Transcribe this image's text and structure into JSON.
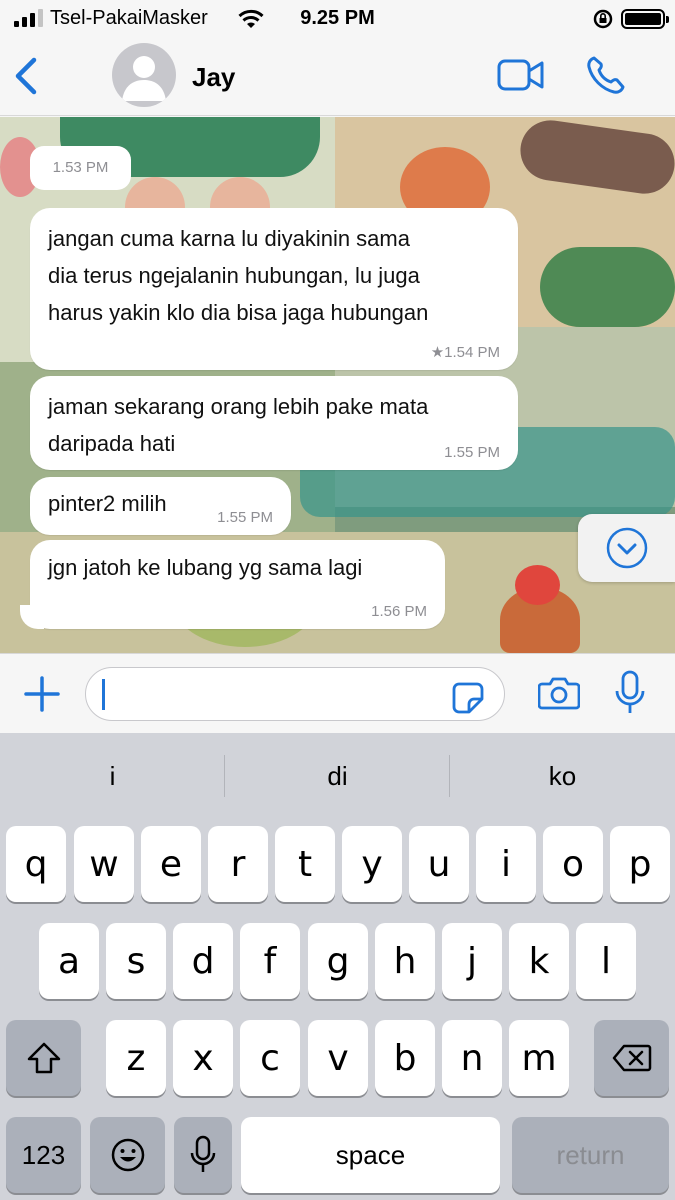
{
  "status_bar": {
    "carrier": "Tsel-PakaiMasker",
    "time": "9.25 PM"
  },
  "header": {
    "contact_name": "Jay"
  },
  "chat": {
    "top_timestamp": "1.53 PM",
    "messages": [
      {
        "lines": [
          "jangan cuma karna lu diyakinin sama",
          "dia terus ngejalanin hubungan, lu juga",
          "harus yakin klo dia bisa jaga hubungan"
        ],
        "time": "★1.54 PM",
        "starred": true
      },
      {
        "lines": [
          "jaman sekarang orang lebih pake mata",
          "daripada hati"
        ],
        "time": "1.55 PM"
      },
      {
        "lines": [
          "pinter2 milih"
        ],
        "time": "1.55 PM"
      },
      {
        "lines": [
          "jgn jatoh ke lubang yg sama lagi"
        ],
        "time": "1.56 PM"
      }
    ]
  },
  "input": {
    "value": ""
  },
  "keyboard": {
    "suggestions": [
      "i",
      "di",
      "ko"
    ],
    "row1": [
      "q",
      "w",
      "e",
      "r",
      "t",
      "y",
      "u",
      "i",
      "o",
      "p"
    ],
    "row2": [
      "a",
      "s",
      "d",
      "f",
      "g",
      "h",
      "j",
      "k",
      "l"
    ],
    "row3": [
      "z",
      "x",
      "c",
      "v",
      "b",
      "n",
      "m"
    ],
    "numbers_label": "123",
    "space_label": "space",
    "return_label": "return"
  },
  "colors": {
    "accent": "#1f75d8",
    "bubble": "#ffffff",
    "keyboard_bg": "#d1d3d9"
  }
}
